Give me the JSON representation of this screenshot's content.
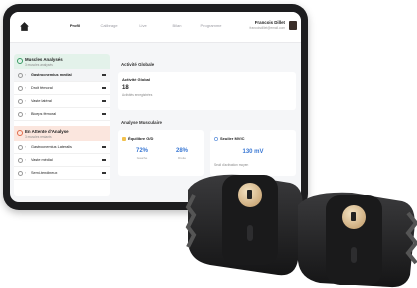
{
  "topbar": {
    "nav": [
      "Profil",
      "Calibrage",
      "Live",
      "Bilan",
      "Programme"
    ],
    "active_index": 0,
    "user_name": "Francois Dillet",
    "user_email": "francoisdillet@email.com"
  },
  "left_panel": {
    "group_analysed": {
      "title": "Muscles Analysés",
      "subtitle": "3 muscles analysés",
      "items": [
        {
          "label": "Gastrocnemius medial",
          "bold": true
        },
        {
          "label": "Droit fémoral",
          "bold": false
        },
        {
          "label": "Vaste latéral",
          "bold": false
        },
        {
          "label": "Biceps fémoral",
          "bold": false
        }
      ]
    },
    "group_pending": {
      "title": "En Attente d'Analyse",
      "subtitle": "3 muscles restants",
      "items": [
        {
          "label": "Gastrocnemius Lateralis"
        },
        {
          "label": "Vaste médial"
        },
        {
          "label": "Semi-tendineux"
        }
      ]
    }
  },
  "main": {
    "global_title": "Activité Globale",
    "global_card_title": "Activité Global",
    "global_value": "18",
    "global_sub": "Activités enregistrées",
    "muscle_title": "Analyse Musculaire",
    "balance_title": "Équilibre G/D",
    "left_pct": "72%",
    "left_label": "Gauche",
    "right_pct": "28%",
    "right_label": "Droite",
    "power_title": "Seuiler MVIC",
    "power_value": "130 mV",
    "power_sub": "Seuil d'activation moyen"
  },
  "colors": {
    "accent_blue": "#3a78d4",
    "group_green": "#e3f2ea",
    "group_red": "#fbe6de"
  }
}
